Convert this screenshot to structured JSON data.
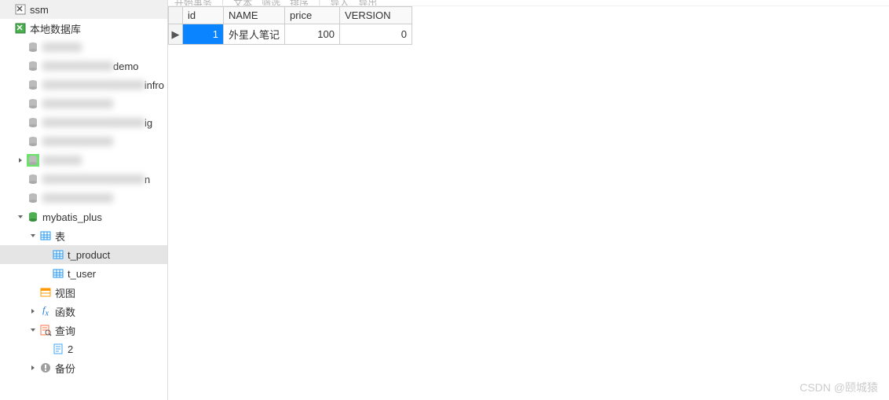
{
  "sidebar": {
    "items": [
      {
        "label": "ssm",
        "icon": "navicat",
        "indent": 0,
        "toggle": "",
        "blur": false
      },
      {
        "label": "本地数据库",
        "icon": "navicat-green",
        "indent": 0,
        "toggle": "",
        "blur": false
      },
      {
        "label": "",
        "icon": "db-gray",
        "indent": 1,
        "toggle": "",
        "blur": true,
        "blurClass": "blur-s"
      },
      {
        "label": "demo",
        "icon": "db-gray",
        "indent": 1,
        "toggle": "",
        "blur": true,
        "blurClass": "blur-m",
        "suffix": "demo"
      },
      {
        "label": "infro",
        "icon": "db-gray",
        "indent": 1,
        "toggle": "",
        "blur": true,
        "blurClass": "blur-l",
        "suffix": "infro"
      },
      {
        "label": "",
        "icon": "db-gray",
        "indent": 1,
        "toggle": "",
        "blur": true,
        "blurClass": "blur-m"
      },
      {
        "label": "ig",
        "icon": "db-gray",
        "indent": 1,
        "toggle": "",
        "blur": true,
        "blurClass": "blur-l",
        "suffix": "ig"
      },
      {
        "label": "",
        "icon": "db-gray",
        "indent": 1,
        "toggle": "",
        "blur": true,
        "blurClass": "blur-m"
      },
      {
        "label": "",
        "icon": "db-gray",
        "indent": 1,
        "toggle": ">",
        "blur": true,
        "blurClass": "blur-s",
        "hl": true
      },
      {
        "label": "n",
        "icon": "db-gray",
        "indent": 1,
        "toggle": "",
        "blur": true,
        "blurClass": "blur-l",
        "suffix": "n"
      },
      {
        "label": "",
        "icon": "db-gray",
        "indent": 1,
        "toggle": "",
        "blur": true,
        "blurClass": "blur-m"
      },
      {
        "label": "mybatis_plus",
        "icon": "db-green",
        "indent": 1,
        "toggle": "v",
        "blur": false
      },
      {
        "label": "表",
        "icon": "table-blue",
        "indent": 2,
        "toggle": "v",
        "blur": false
      },
      {
        "label": "t_product",
        "icon": "table-blue",
        "indent": 3,
        "toggle": "",
        "blur": false,
        "selected": true
      },
      {
        "label": "t_user",
        "icon": "table-blue",
        "indent": 3,
        "toggle": "",
        "blur": false
      },
      {
        "label": "视图",
        "icon": "view",
        "indent": 2,
        "toggle": "",
        "blur": false
      },
      {
        "label": "函数",
        "icon": "fx",
        "indent": 2,
        "toggle": ">",
        "blur": false
      },
      {
        "label": "查询",
        "icon": "query",
        "indent": 2,
        "toggle": "v",
        "blur": false
      },
      {
        "label": "2",
        "icon": "query-item",
        "indent": 3,
        "toggle": "",
        "blur": false
      },
      {
        "label": "备份",
        "icon": "backup",
        "indent": 2,
        "toggle": ">",
        "blur": false
      }
    ]
  },
  "toolbar": {
    "begin_tx": "开始事务",
    "text": "文本",
    "filter": "筛选",
    "sort": "排序",
    "import": "导入",
    "export": "导出"
  },
  "table": {
    "columns": [
      "id",
      "NAME",
      "price",
      "VERSION"
    ],
    "rows": [
      {
        "marker": "▶",
        "id": "1",
        "name": "外星人笔记",
        "price": "100",
        "version": "0",
        "id_selected": true
      }
    ]
  },
  "watermark": "CSDN @颐城猿"
}
